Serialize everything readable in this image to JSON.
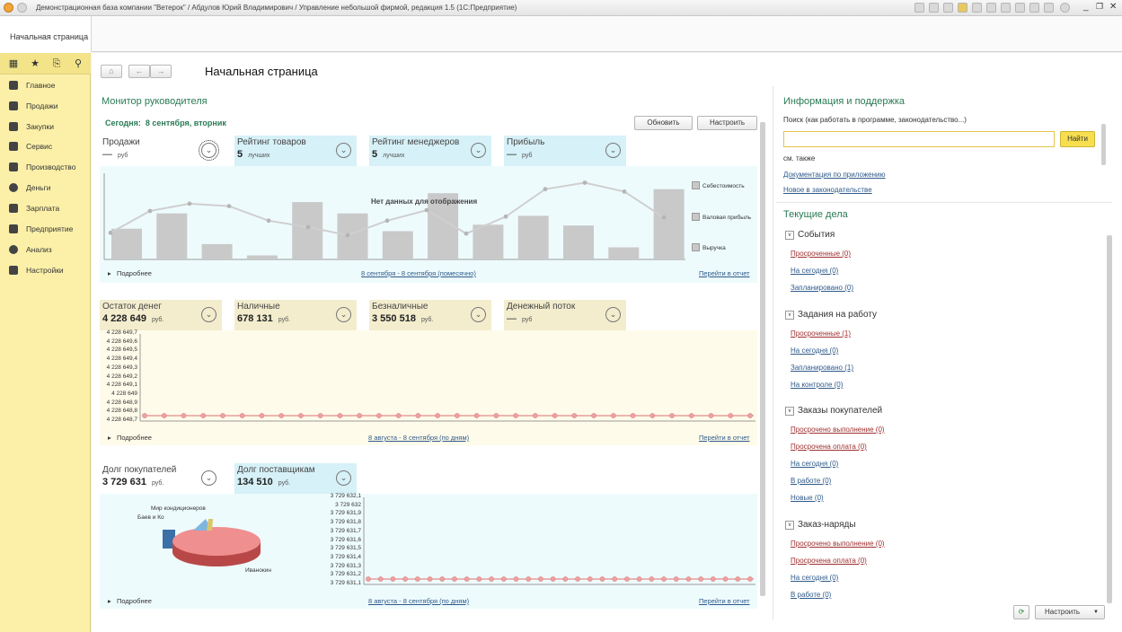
{
  "window": {
    "title": "Демонстрационная база компании \"Ветерок\" / Абдулов Юрий Владимирович / Управление небольшой фирмой, редакция 1.5  (1С:Предприятие)"
  },
  "tabs": [
    {
      "label": "Начальная страница"
    }
  ],
  "sidebar": {
    "items": [
      {
        "label": "Главное",
        "icon": "list-icon"
      },
      {
        "label": "Продажи",
        "icon": "basket-icon"
      },
      {
        "label": "Закупки",
        "icon": "truck-icon"
      },
      {
        "label": "Сервис",
        "icon": "wrench-icon"
      },
      {
        "label": "Производство",
        "icon": "factory-icon"
      },
      {
        "label": "Деньги",
        "icon": "coin-icon"
      },
      {
        "label": "Зарплата",
        "icon": "people-icon"
      },
      {
        "label": "Предприятие",
        "icon": "building-icon"
      },
      {
        "label": "Анализ",
        "icon": "chart-icon"
      },
      {
        "label": "Настройки",
        "icon": "gear-icon"
      }
    ]
  },
  "page": {
    "title": "Начальная страница"
  },
  "monitor": {
    "title": "Монитор руководителя",
    "today": "Сегодня:  8 сентября, вторник",
    "refresh_label": "Обновить",
    "settings_label": "Настроить",
    "sales": {
      "cards": [
        {
          "label": "Продажи",
          "value": "—",
          "unit": "руб"
        },
        {
          "label": "Рейтинг товаров",
          "value": "5",
          "unit": "лучших"
        },
        {
          "label": "Рейтинг менеджеров",
          "value": "5",
          "unit": "лучших"
        },
        {
          "label": "Прибыль",
          "value": "—",
          "unit": "руб"
        }
      ],
      "more": "Подробнее",
      "period": "8 сентября - 8 сентября (помесячно)",
      "report": "Перейти в отчет",
      "nodata": "Нет данных для отображения",
      "legend": [
        "Себестоимость",
        "Валовая прибыль",
        "Выручка"
      ]
    },
    "money": {
      "cards": [
        {
          "label": "Остаток денег",
          "value": "4 228 649",
          "unit": "руб."
        },
        {
          "label": "Наличные",
          "value": "678 131",
          "unit": "руб."
        },
        {
          "label": "Безналичные",
          "value": "3 550 518",
          "unit": "руб."
        },
        {
          "label": "Денежный поток",
          "value": "—",
          "unit": "руб"
        }
      ],
      "yticks": [
        "4 228 649,7",
        "4 228 649,6",
        "4 228 649,5",
        "4 228 649,4",
        "4 228 649,3",
        "4 228 649,2",
        "4 228 649,1",
        "4 228 649",
        "4 228 648,9",
        "4 228 648,8",
        "4 228 648,7"
      ],
      "more": "Подробнее",
      "period": "8 августа - 8 сентября (по дням)",
      "report": "Перейти в отчет"
    },
    "debts": {
      "cards": [
        {
          "label": "Долг покупателей",
          "value": "3 729 631",
          "unit": "руб."
        },
        {
          "label": "Долг поставщикам",
          "value": "134 510",
          "unit": "руб."
        }
      ],
      "pie_labels": [
        "Мир кондиционеров",
        "Баев и Ко",
        "Иванокин"
      ],
      "yticks": [
        "3 729 632,1",
        "3 729 632",
        "3 729 631,9",
        "3 729 631,8",
        "3 729 631,7",
        "3 729 631,6",
        "3 729 631,5",
        "3 729 631,4",
        "3 729 631,3",
        "3 729 631,2",
        "3 729 631,1"
      ],
      "more": "Подробнее",
      "period": "8 августа - 8 сентября (по дням)",
      "report": "Перейти в отчет"
    }
  },
  "info": {
    "title": "Информация и поддержка",
    "search_label": "Поиск (как работать в программе, законодательство...)",
    "search_value": "",
    "find_label": "Найти",
    "see_also": "см. также",
    "links": [
      "Документация по приложению",
      "Новое в законодательстве"
    ]
  },
  "tasks": {
    "title": "Текущие дела",
    "groups": [
      {
        "title": "События",
        "items": [
          "Просроченные (0)",
          "На сегодня (0)",
          "Запланировано (0)"
        ]
      },
      {
        "title": "Задания на работу",
        "items": [
          "Просроченные (1)",
          "На сегодня (0)",
          "Запланировано (1)",
          "На контроле (0)"
        ]
      },
      {
        "title": "Заказы покупателей",
        "items": [
          "Просрочено выполнение (0)",
          "Просрочена оплата (0)",
          "На сегодня (0)",
          "В работе (0)",
          "Новые (0)"
        ]
      },
      {
        "title": "Заказ-наряды",
        "items": [
          "Просрочено выполнение (0)",
          "Просрочена оплата (0)",
          "На сегодня (0)",
          "В работе (0)"
        ]
      }
    ],
    "settings_label": "Настроить"
  },
  "chart_data": [
    {
      "type": "bar",
      "legend": [
        "Себестоимость",
        "Валовая прибыль",
        "Выручка"
      ],
      "values": [
        38,
        57,
        19,
        5,
        71,
        57,
        35,
        82,
        43,
        54,
        42,
        15,
        87
      ],
      "line": [
        33,
        60,
        69,
        66,
        48,
        40,
        30,
        48,
        61,
        32,
        53,
        87,
        95,
        84,
        52
      ],
      "ylim": [
        0,
        100
      ],
      "annotation": "Нет данных для отображения"
    },
    {
      "type": "line",
      "yticks": [
        "4 228 649,7",
        "4 228 649,6",
        "4 228 649,5",
        "4 228 649,4",
        "4 228 649,3",
        "4 228 649,2",
        "4 228 649,1",
        "4 228 649",
        "4 228 648,9",
        "4 228 648,8",
        "4 228 648,7"
      ],
      "y": 4228648.7,
      "points": 32,
      "period": "8 августа - 8 сентября (по дням)"
    },
    {
      "type": "pie",
      "labels": [
        "Мир кондиционеров",
        "Баев и Ко",
        "Иванокин"
      ],
      "values": [
        5,
        10,
        85
      ]
    },
    {
      "type": "line",
      "yticks": [
        "3 729 632,1",
        "3 729 632",
        "3 729 631,9",
        "3 729 631,8",
        "3 729 631,7",
        "3 729 631,6",
        "3 729 631,5",
        "3 729 631,4",
        "3 729 631,3",
        "3 729 631,2",
        "3 729 631,1"
      ],
      "y": 3729631.1,
      "points": 32,
      "period": "8 августа - 8 сентября (по дням)"
    }
  ]
}
